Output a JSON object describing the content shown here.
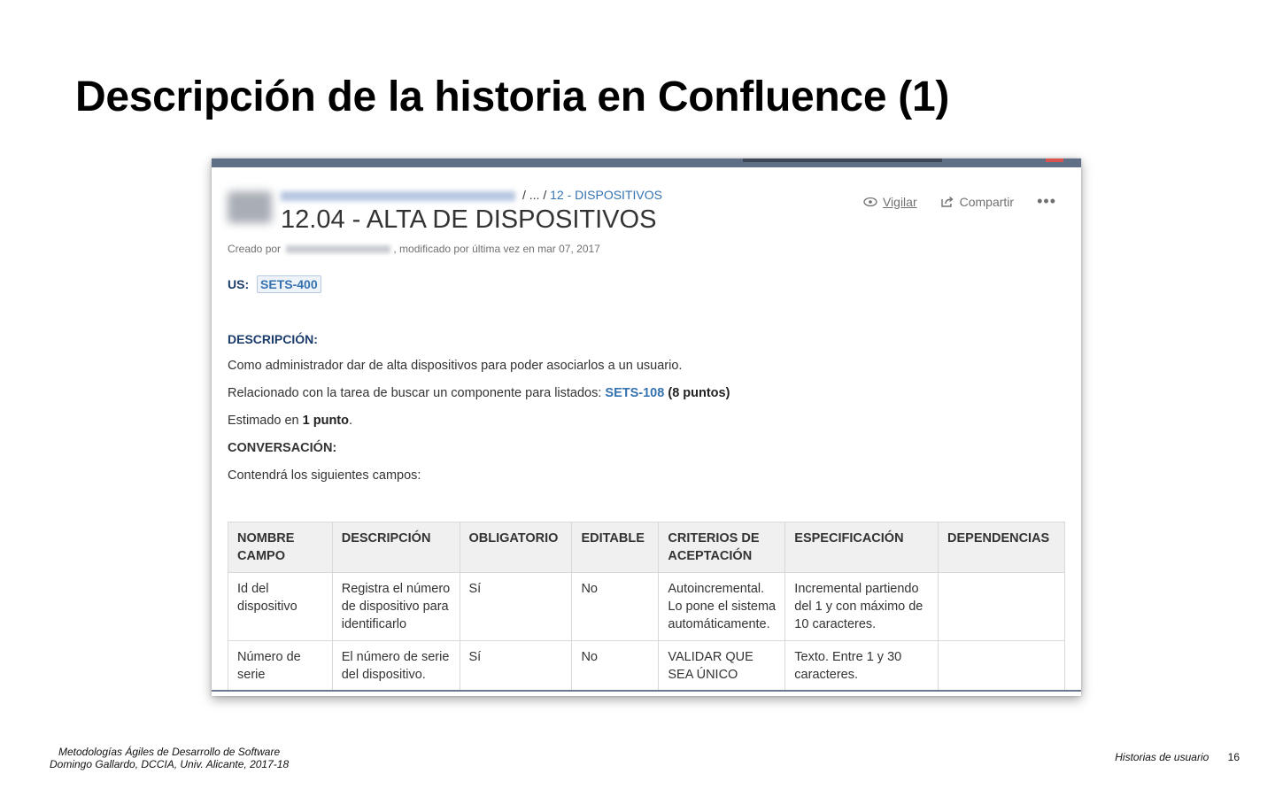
{
  "slide": {
    "title": "Descripción de la historia en Confluence (1)",
    "footer_line1": "Metodologías Ágiles de Desarrollo de Software",
    "footer_line2": "Domingo Gallardo, DCCIA, Univ. Alicante, 2017-18",
    "footer_section": "Historias de usuario",
    "page_number": "16"
  },
  "confluence": {
    "breadcrumb_sep": "/ ... /",
    "breadcrumb_parent": "12 - DISPOSITIVOS",
    "page_title": "12.04 - ALTA DE DISPOSITIVOS",
    "meta_created": "Creado por",
    "meta_modified": ", modificado por última vez en mar 07, 2017",
    "actions": {
      "watch": "Vigilar",
      "share": "Compartir",
      "more": "•••"
    },
    "us_label": "US:",
    "us_ticket": "SETS-400",
    "description_heading": "DESCRIPCIÓN:",
    "description_text": "Como administrador dar de alta dispositivos para poder asociarlos a un usuario.",
    "related_text": "Relacionado con la tarea de buscar un componente para listados:",
    "related_ticket": "SETS-108",
    "related_points": "(8 puntos)",
    "estimate_prefix": "Estimado en",
    "estimate_value": "1 punto",
    "estimate_suffix": ".",
    "conversation_heading": "CONVERSACIÓN:",
    "fields_intro": "Contendrá los siguientes campos:",
    "table": {
      "headers": [
        "NOMBRE CAMPO",
        "DESCRIPCIÓN",
        "OBLIGATORIO",
        "EDITABLE",
        "CRITERIOS DE ACEPTACIÓN",
        "ESPECIFICACIÓN",
        "DEPENDENCIAS"
      ],
      "rows": [
        [
          "Id del dispositivo",
          "Registra el número de dispositivo para identificarlo",
          "Sí",
          "No",
          "Autoincremental. Lo pone el sistema automáticamente.",
          "Incremental partiendo del 1 y con máximo de 10 caracteres.",
          ""
        ],
        [
          "Número de serie",
          "El número de serie del dispositivo.",
          "Sí",
          "No",
          "VALIDAR QUE SEA ÚNICO",
          "Texto. Entre 1 y 30 caracteres.",
          ""
        ]
      ]
    }
  }
}
